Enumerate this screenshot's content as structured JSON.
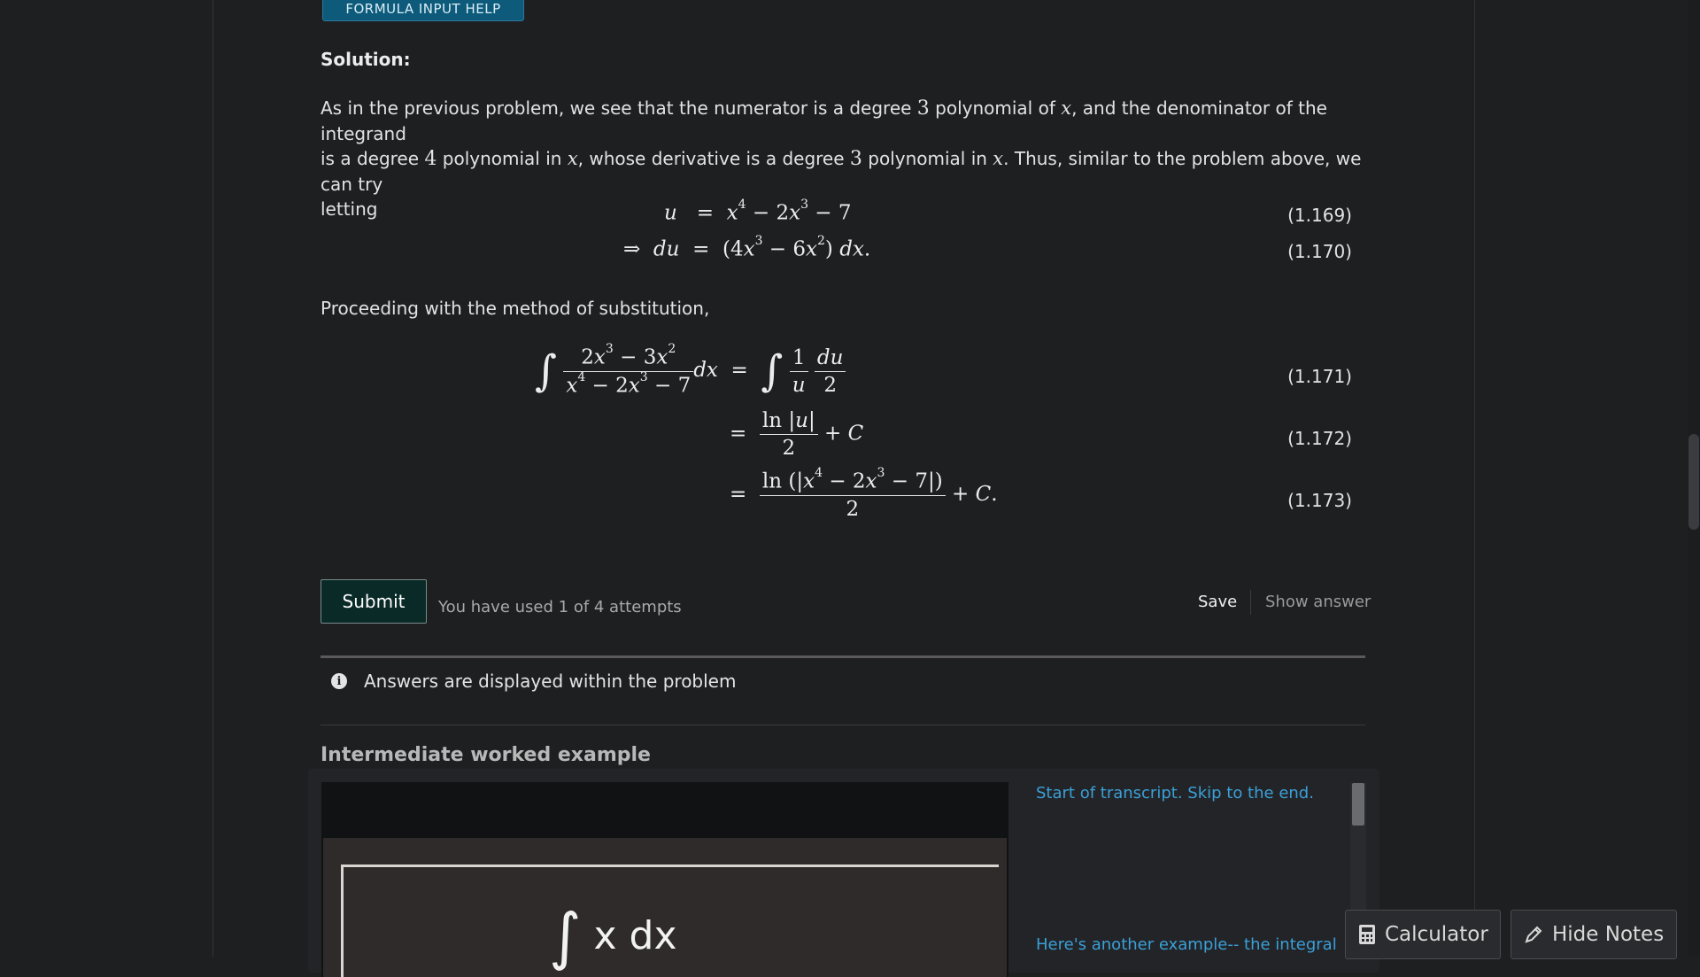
{
  "toolbar": {
    "formula_help_label": "FORMULA INPUT HELP"
  },
  "solution": {
    "label": "Solution:",
    "intro": {
      "p1": "As in the previous problem, we see that the numerator is a degree ",
      "n3a": "3",
      "p2": " polynomial of ",
      "x1": "x",
      "p3": ", and the denominator of the integrand",
      "p4": "is a degree ",
      "n4": "4",
      "p5": " polynomial in ",
      "x2": "x",
      "p6": ", whose derivative is a degree ",
      "n3b": "3",
      "p7": " polynomial in ",
      "x3": "x",
      "p8": ". Thus, similar to the problem above, we can try",
      "p9": "letting"
    },
    "eq_numbers": [
      "(1.169)",
      "(1.170)",
      "(1.171)",
      "(1.172)",
      "(1.173)"
    ],
    "proceeding": "Proceeding with the method of substitution,"
  },
  "actions": {
    "submit_label": "Submit",
    "attempts_text": "You have used 1 of 4 attempts",
    "save_label": "Save",
    "show_answer_label": "Show answer"
  },
  "notice": {
    "text": "Answers are displayed within the problem"
  },
  "worked_example": {
    "title": "Intermediate worked example",
    "transcript_start": "Start of transcript. Skip to the end.",
    "transcript_line": "Here's another example-- the integral",
    "board_text": "x dx"
  },
  "floating": {
    "calculator_label": "Calculator",
    "hide_notes_label": "Hide Notes"
  },
  "icons": [
    "info-icon",
    "calculator-icon",
    "pencil-icon"
  ]
}
